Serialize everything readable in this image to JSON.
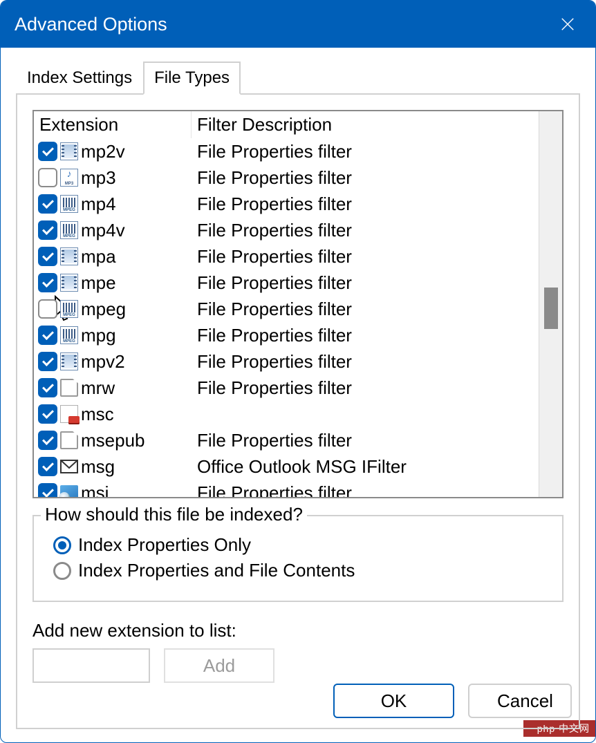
{
  "window": {
    "title": "Advanced Options"
  },
  "tabs": [
    {
      "label": "Index Settings",
      "active": false
    },
    {
      "label": "File Types",
      "active": true
    }
  ],
  "list": {
    "headers": {
      "ext": "Extension",
      "filter": "Filter Description"
    },
    "rows": [
      {
        "checked": true,
        "icon": "video",
        "ext": "mp2v",
        "filter": "File Properties filter"
      },
      {
        "checked": false,
        "icon": "mp3",
        "ext": "mp3",
        "filter": "File Properties filter"
      },
      {
        "checked": true,
        "icon": "mpeg",
        "ext": "mp4",
        "filter": "File Properties filter"
      },
      {
        "checked": true,
        "icon": "mpeg",
        "ext": "mp4v",
        "filter": "File Properties filter"
      },
      {
        "checked": true,
        "icon": "video",
        "ext": "mpa",
        "filter": "File Properties filter"
      },
      {
        "checked": true,
        "icon": "video",
        "ext": "mpe",
        "filter": "File Properties filter"
      },
      {
        "checked": false,
        "icon": "mpeg",
        "ext": "mpeg",
        "filter": "File Properties filter"
      },
      {
        "checked": true,
        "icon": "mpeg",
        "ext": "mpg",
        "filter": "File Properties filter"
      },
      {
        "checked": true,
        "icon": "video",
        "ext": "mpv2",
        "filter": "File Properties filter"
      },
      {
        "checked": true,
        "icon": "file",
        "ext": "mrw",
        "filter": "File Properties filter"
      },
      {
        "checked": true,
        "icon": "msc",
        "ext": "msc",
        "filter": ""
      },
      {
        "checked": true,
        "icon": "file",
        "ext": "msepub",
        "filter": "File Properties filter"
      },
      {
        "checked": true,
        "icon": "msg",
        "ext": "msg",
        "filter": "Office Outlook MSG IFilter"
      },
      {
        "checked": true,
        "icon": "msi",
        "ext": "msi",
        "filter": "File Properties filter"
      }
    ]
  },
  "group": {
    "label": "How should this file be indexed?",
    "option1": "Index Properties Only",
    "option2": "Index Properties and File Contents",
    "selected": 1
  },
  "addExtension": {
    "label": "Add new extension to list:",
    "buttonLabel": "Add",
    "value": ""
  },
  "footer": {
    "ok": "OK",
    "cancel": "Cancel"
  },
  "watermark": "php 中文网"
}
